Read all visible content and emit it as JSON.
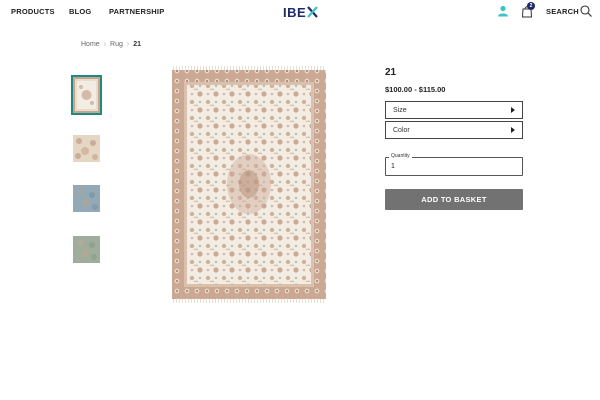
{
  "header": {
    "nav": [
      "PRODUCTS",
      "BLOG",
      "PARTNERSHIP"
    ],
    "logo": "IBE",
    "cart_count": "2",
    "search_label": "SEARCH"
  },
  "breadcrumb": [
    "Home",
    "Rug",
    "21"
  ],
  "thumbnails": [
    {
      "name": "cream-rug",
      "active": true
    },
    {
      "name": "beige-floral-rug",
      "active": false
    },
    {
      "name": "blue-rug",
      "active": false
    },
    {
      "name": "green-rug",
      "active": false
    }
  ],
  "product": {
    "title": "21",
    "price": "$100.00 - $115.00",
    "size_label": "Size",
    "color_label": "Color",
    "quantity_label": "Quantity",
    "quantity_value": "1",
    "add_button": "ADD TO BASKET"
  },
  "colors": {
    "brand": "#1f2a6b",
    "accent": "#1d8a86",
    "user_icon": "#3cc3c7",
    "button": "#727272"
  }
}
